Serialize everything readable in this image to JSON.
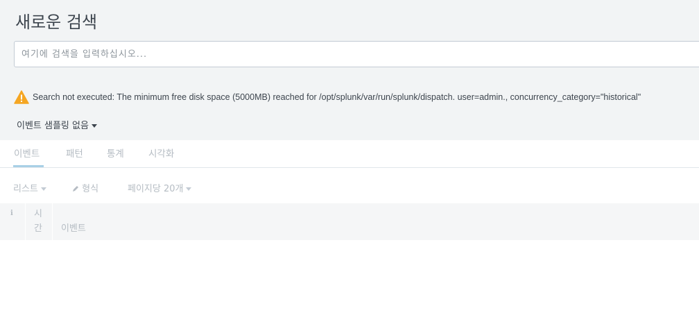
{
  "header": {
    "title": "새로운 검색"
  },
  "search": {
    "placeholder": "여기에 검색을 입력하십시오..."
  },
  "warning": {
    "icon": "warning-icon",
    "color": "#f5a623",
    "message": "Search not executed: The minimum free disk space (5000MB) reached for /opt/splunk/var/run/splunk/dispatch. user=admin., concurrency_category=\"historical\""
  },
  "sampling": {
    "label": "이벤트 샘플링 없음"
  },
  "tabs": [
    {
      "label": "이벤트",
      "active": true
    },
    {
      "label": "패턴",
      "active": false
    },
    {
      "label": "통계",
      "active": false
    },
    {
      "label": "시각화",
      "active": false
    }
  ],
  "toolbar": {
    "list_label": "리스트",
    "format_label": "형식",
    "per_page_label": "페이지당 20개"
  },
  "table": {
    "info_header": "i",
    "time_header": "시간",
    "event_header": "이벤트"
  }
}
